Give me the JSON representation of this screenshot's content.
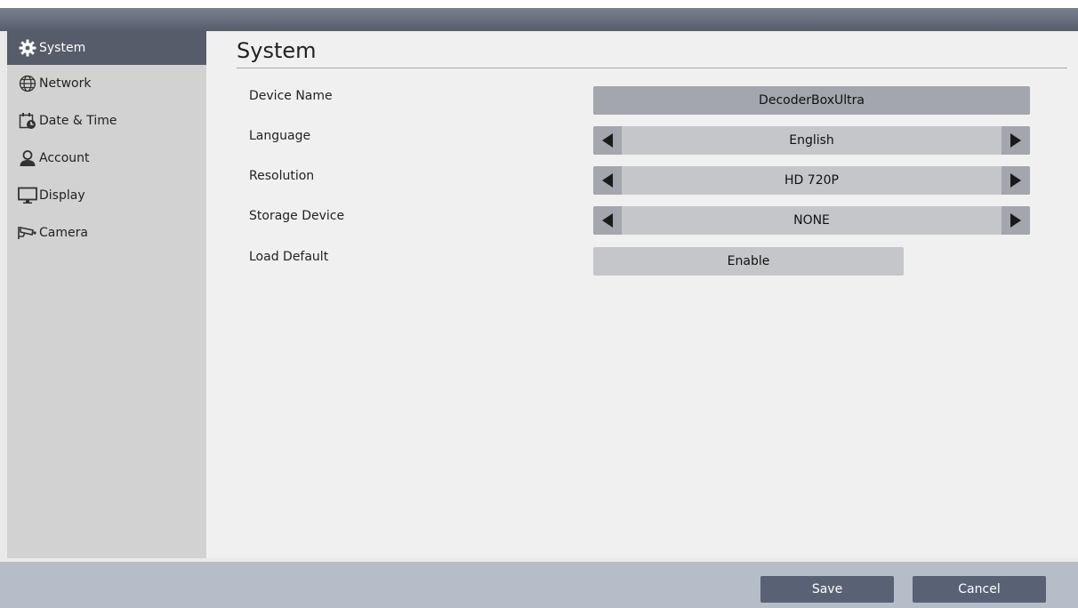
{
  "sidebar": {
    "items": [
      {
        "label": "System",
        "icon": "gear-icon"
      },
      {
        "label": "Network",
        "icon": "globe-icon"
      },
      {
        "label": "Date & Time",
        "icon": "calendar-clock-icon"
      },
      {
        "label": "Account",
        "icon": "user-icon"
      },
      {
        "label": "Display",
        "icon": "monitor-icon"
      },
      {
        "label": "Camera",
        "icon": "camera-icon"
      }
    ],
    "active": "System"
  },
  "main": {
    "title": "System",
    "rows": [
      {
        "label": "Device Name",
        "value": "DecoderBoxUltra"
      },
      {
        "label": "Language",
        "value": "English"
      },
      {
        "label": "Resolution",
        "value": "HD 720P"
      },
      {
        "label": "Storage Device",
        "value": "NONE"
      },
      {
        "label": "Load Default",
        "value": "Enable"
      }
    ]
  },
  "footer": {
    "save_label": "Save",
    "cancel_label": "Cancel"
  },
  "colors": {
    "sidebar_active": "#575c6b",
    "sidebar_bg": "#d2d2d2",
    "main_bg": "#f0f0f0",
    "footer_bg": "#b5bdc9",
    "button_bg": "#596275"
  }
}
